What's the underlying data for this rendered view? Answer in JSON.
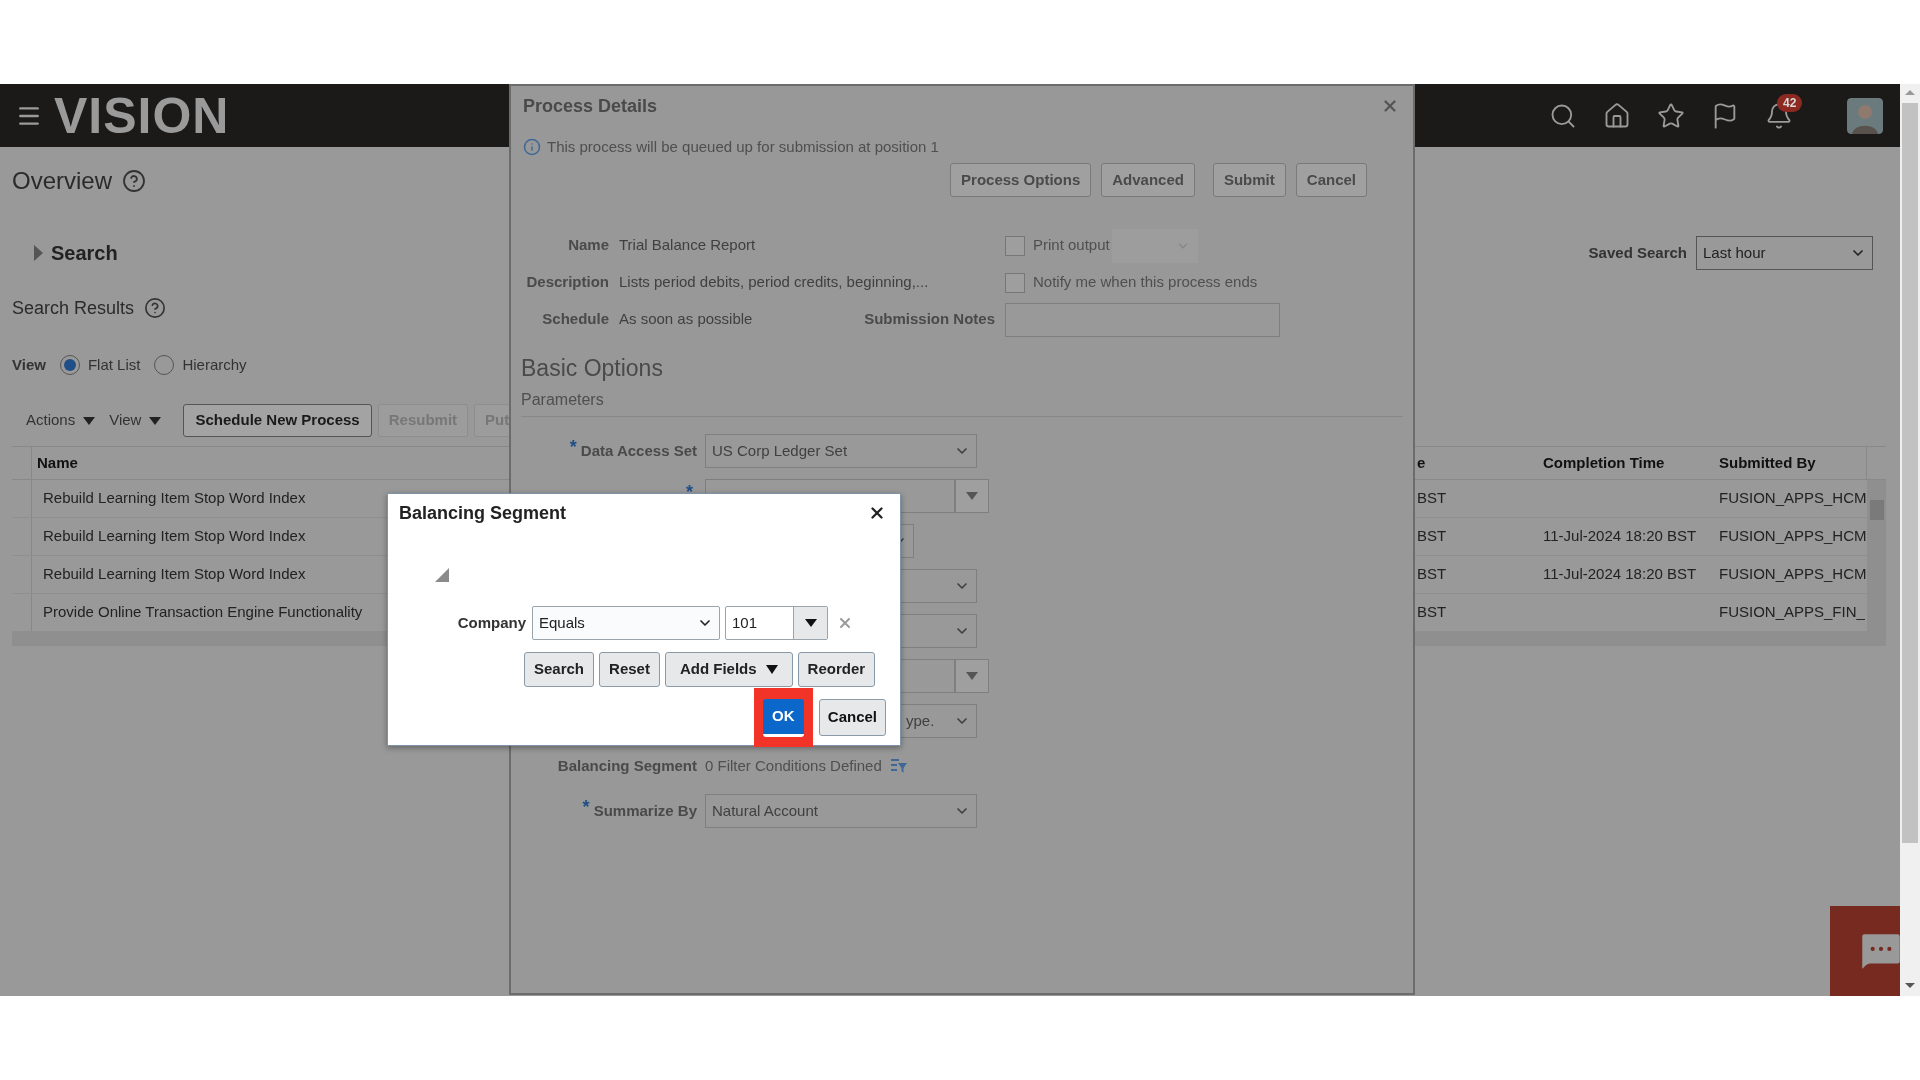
{
  "header": {
    "logo": "VISION",
    "notification_count": "42"
  },
  "page": {
    "title": "Overview",
    "search_section": {
      "label": "Search",
      "expanded": false
    },
    "saved_search": {
      "label": "Saved Search",
      "value": "Last hour"
    },
    "search_results_title": "Search Results",
    "view": {
      "label": "View",
      "options": [
        {
          "label": "Flat List",
          "selected": true
        },
        {
          "label": "Hierarchy",
          "selected": false
        }
      ]
    },
    "toolbar": {
      "menus": [
        "Actions",
        "View"
      ],
      "buttons": [
        {
          "label": "Schedule New Process",
          "disabled": false
        },
        {
          "label": "Resubmit",
          "disabled": true
        },
        {
          "label": "Put",
          "disabled": true
        }
      ]
    },
    "table": {
      "columns": [
        "Name",
        "e",
        "Completion Time",
        "Submitted By"
      ],
      "rows": [
        {
          "name": "Rebuild Learning Item Stop Word Index",
          "column_2": "BST",
          "submitted_by": "FUSION_APPS_HCM"
        },
        {
          "name": "Rebuild Learning Item Stop Word Index",
          "column_2": "BST",
          "completion_time": "11-Jul-2024 18:20 BST",
          "submitted_by": "FUSION_APPS_HCM"
        },
        {
          "name": "Rebuild Learning Item Stop Word Index",
          "column_2": "BST",
          "completion_time": "11-Jul-2024 18:20 BST",
          "submitted_by": "FUSION_APPS_HCM"
        },
        {
          "name": "Provide Online Transaction Engine Functionality",
          "column_2": "BST",
          "submitted_by": "FUSION_APPS_FIN_"
        }
      ]
    }
  },
  "process_details": {
    "title": "Process Details",
    "info": "This process will be queued up for submission at position 1",
    "buttons": [
      {
        "label": "Process Options"
      },
      {
        "label": "Advanced"
      },
      {
        "label": "Submit"
      },
      {
        "label": "Cancel"
      }
    ],
    "required_marker": "*",
    "fields": [
      {
        "label": "Name",
        "value": "Trial Balance Report"
      },
      {
        "label": "Description",
        "value": "Lists period debits, period credits, beginning,..."
      },
      {
        "label": "Schedule",
        "value": "As soon as possible"
      }
    ],
    "options": [
      {
        "kind": "checkbox",
        "label": "Print output",
        "checked": false,
        "has_select": true
      },
      {
        "kind": "checkbox",
        "label": "Notify me when this process ends",
        "checked": false
      },
      {
        "kind": "notes",
        "label": "Submission Notes"
      }
    ],
    "section_title": "Basic Options",
    "subsection_title": "Parameters",
    "parameters": [
      {
        "kind": "select",
        "label": "Data Access Set",
        "required": true,
        "value": "US Corp Ledger Set"
      },
      {
        "kind": "lov",
        "required": true
      },
      {
        "kind": "select_short",
        "required": false
      },
      {
        "kind": "select",
        "required": false
      },
      {
        "kind": "select",
        "required": false
      },
      {
        "kind": "lov",
        "required": false
      },
      {
        "kind": "select_tail",
        "required": false,
        "value": "ype."
      },
      {
        "kind": "filter",
        "label": "Balancing Segment",
        "required": false,
        "value": "0 Filter Conditions Defined"
      },
      {
        "kind": "select",
        "label": "Summarize By",
        "required": true,
        "value": "Natural Account"
      }
    ]
  },
  "balancing_dialog": {
    "title": "Balancing Segment",
    "filter": {
      "label": "Company",
      "operator": "Equals",
      "value": "101"
    },
    "buttons": [
      {
        "label": "Search",
        "menu": false
      },
      {
        "label": "Reset",
        "menu": false
      },
      {
        "label": "Add Fields",
        "menu": true
      },
      {
        "label": "Reorder",
        "menu": false
      }
    ],
    "footer": [
      {
        "label": "OK",
        "primary": true,
        "highlighted": true
      },
      {
        "label": "Cancel",
        "primary": false,
        "highlighted": false
      }
    ]
  }
}
